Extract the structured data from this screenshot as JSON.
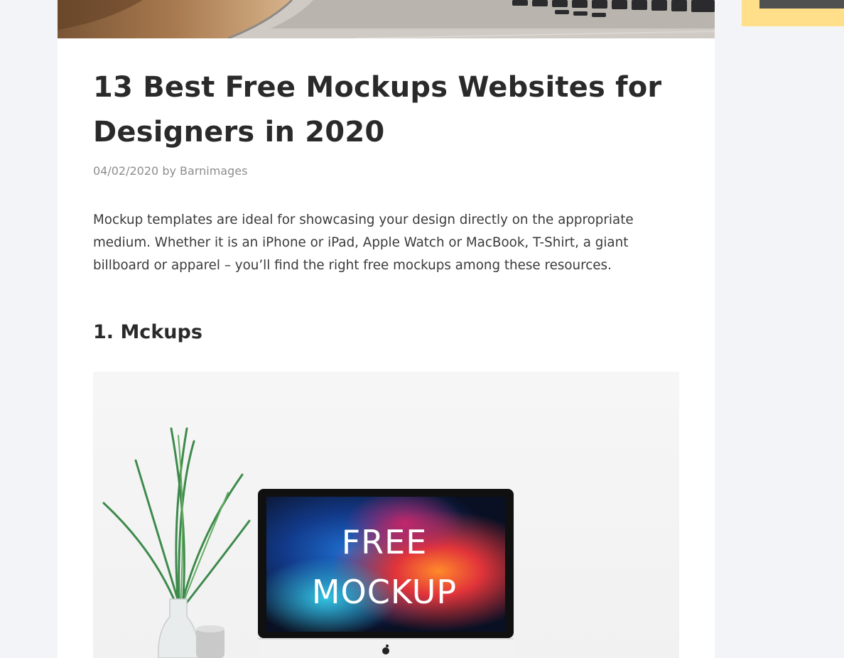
{
  "article": {
    "title": "13 Best Free Mockups Websites for Designers in 2020",
    "date": "04/02/2020",
    "by_label": "by",
    "author": "Barnimages",
    "intro": "Mockup templates are ideal for showcasing your design directly on the appropriate medium. Whether it is an iPhone or iPad, Apple Watch or MacBook, T-Shirt, a giant billboard or apparel – you’ll find the right free mockups among these resources.",
    "sections": [
      {
        "heading": "1. Mckups",
        "image": {
          "subject": "imac-on-desk-mockup",
          "screen_text_line1": "FREE",
          "screen_text_line2": "MOCKUP"
        }
      }
    ]
  },
  "colors": {
    "page_background": "#f3f4f8",
    "card_background": "#ffffff",
    "title_text": "#2a2a2a",
    "meta_text": "#8d8d8d",
    "body_text": "#3a3a3a",
    "sidebar_accent": "#ffdf8a",
    "sidebar_dark": "#505050"
  }
}
